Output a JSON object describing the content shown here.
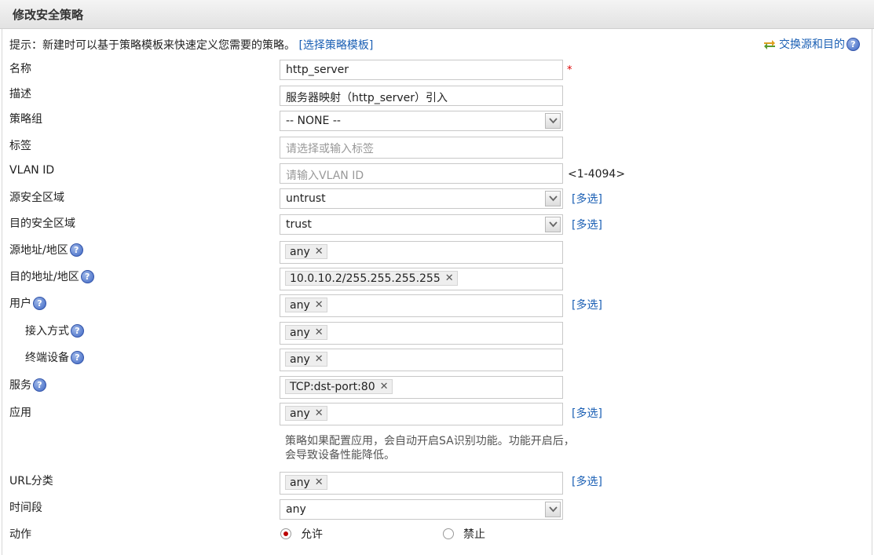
{
  "window": {
    "title": "修改安全策略"
  },
  "hint": {
    "text": "提示：新建时可以基于策略模板来快速定义您需要的策略。",
    "link": "[选择策略模板]"
  },
  "swap": {
    "label": "交换源和目的"
  },
  "help_glyph": "?",
  "required_mark": "*",
  "fields": {
    "name": {
      "label": "名称",
      "value": "http_server"
    },
    "desc": {
      "label": "描述",
      "value": "服务器映射（http_server）引入"
    },
    "group": {
      "label": "策略组",
      "value": "-- NONE --"
    },
    "tag": {
      "label": "标签",
      "placeholder": "请选择或输入标签"
    },
    "vlan": {
      "label": "VLAN ID",
      "placeholder": "请输入VLAN ID",
      "range": "<1-4094>"
    },
    "src_zone": {
      "label": "源安全区域",
      "value": "untrust",
      "action": "[多选]"
    },
    "dst_zone": {
      "label": "目的安全区域",
      "value": "trust",
      "action": "[多选]"
    },
    "src_addr": {
      "label": "源地址/地区",
      "tag": "any"
    },
    "dst_addr": {
      "label": "目的地址/地区",
      "tag": "10.0.10.2/255.255.255.255"
    },
    "user": {
      "label": "用户",
      "tag": "any",
      "action": "[多选]"
    },
    "access": {
      "label": "接入方式",
      "tag": "any"
    },
    "device": {
      "label": "终端设备",
      "tag": "any"
    },
    "service": {
      "label": "服务",
      "tag": "TCP:dst-port:80"
    },
    "app": {
      "label": "应用",
      "tag": "any",
      "action": "[多选]",
      "note": "策略如果配置应用，会自动开启SA识别功能。功能开启后，会导致设备性能降低。"
    },
    "url": {
      "label": "URL分类",
      "tag": "any",
      "action": "[多选]"
    },
    "time": {
      "label": "时间段",
      "value": "any"
    },
    "action": {
      "label": "动作",
      "allow": "允许",
      "deny": "禁止",
      "selected": "allow"
    }
  },
  "colors": {
    "link": "#1a5fb4",
    "required": "#dd0000",
    "radio_selected": "#bb0000"
  }
}
